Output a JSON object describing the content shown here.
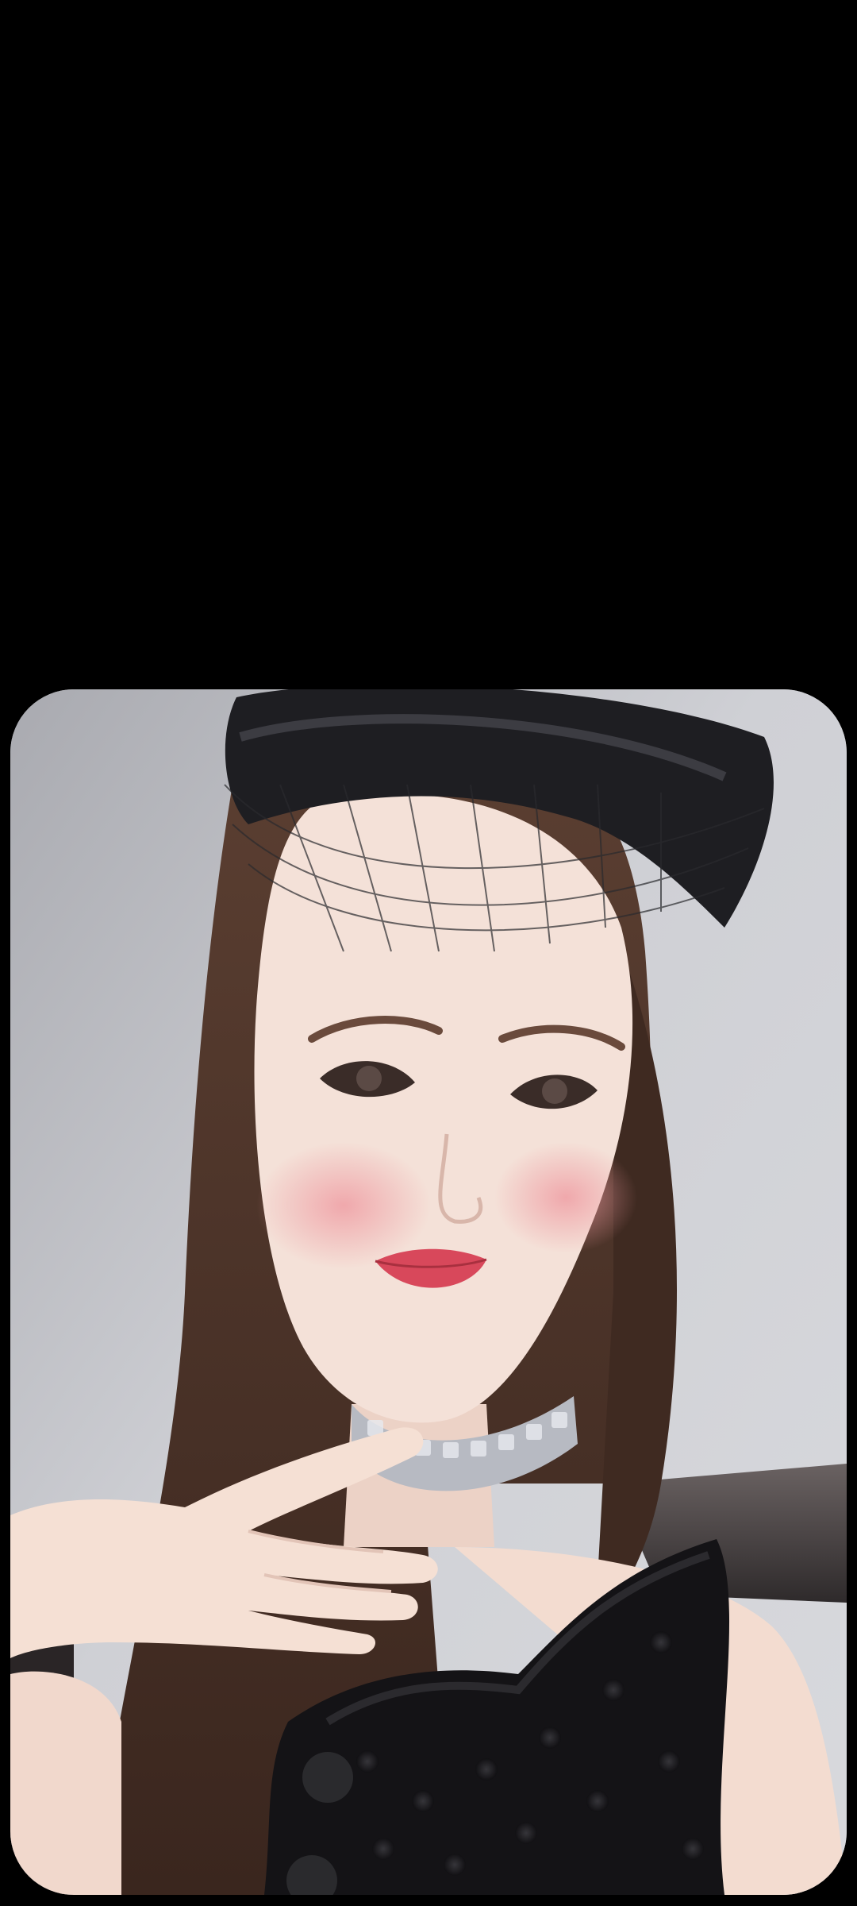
{
  "screen": {
    "background_color": "#000000"
  },
  "photo": {
    "subject_colors": {
      "wall": "#c9cacf",
      "wall_shadow": "#8f9096",
      "shelf": "#4a4343",
      "hair": "#4b3328",
      "skin": "#f3dfd6",
      "blush": "#f1a9ad",
      "lips": "#d94a5d",
      "hat": "#1d1d20",
      "choker": "#b9bcc4",
      "dress": "#151417"
    }
  }
}
